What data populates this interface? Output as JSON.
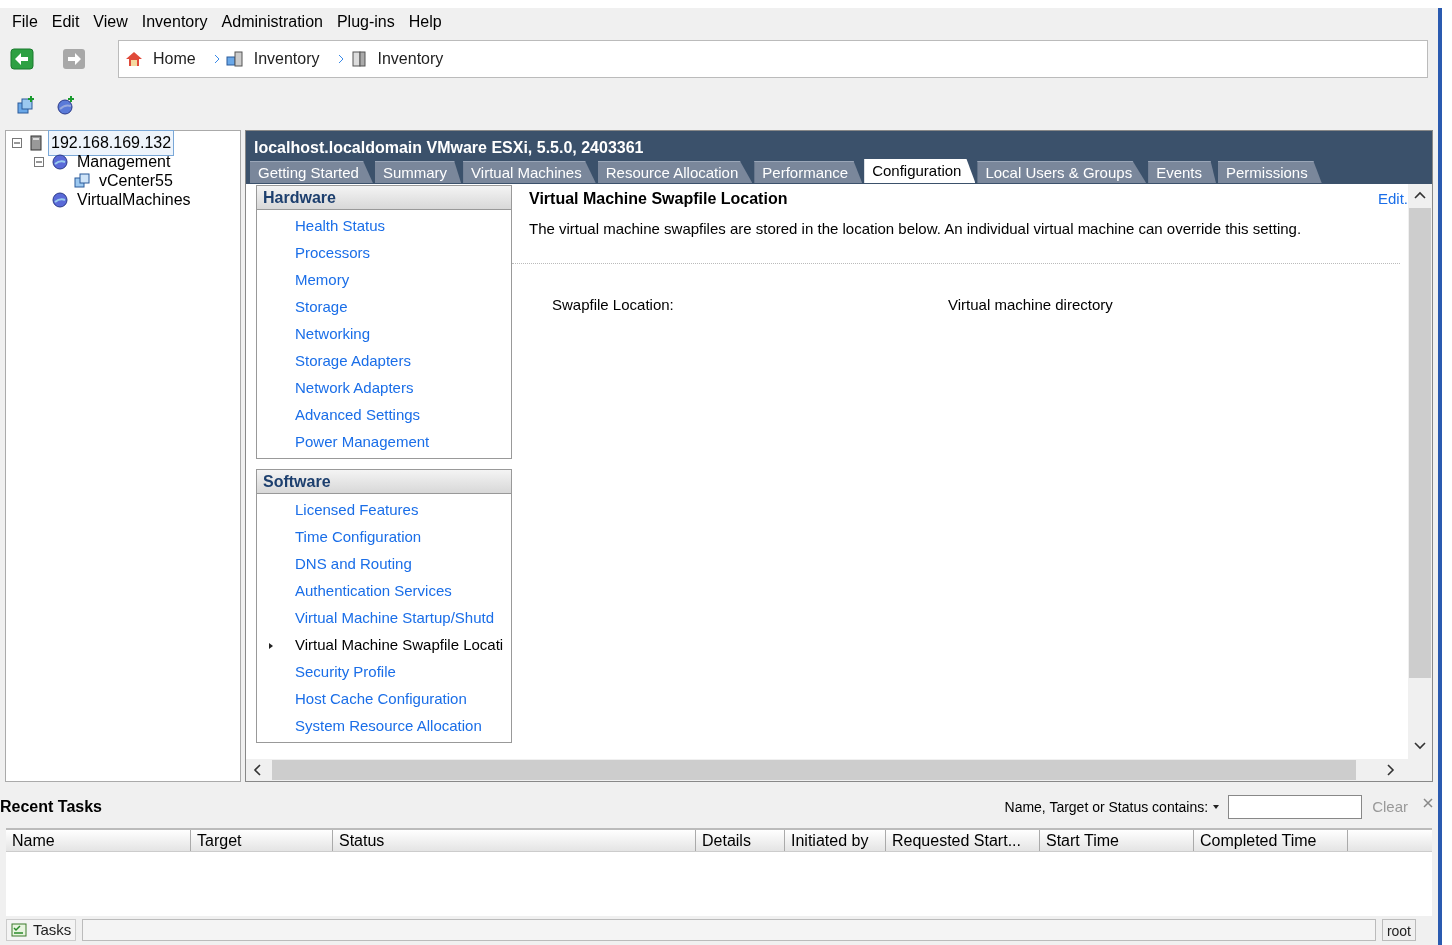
{
  "menu": [
    "File",
    "Edit",
    "View",
    "Inventory",
    "Administration",
    "Plug-ins",
    "Help"
  ],
  "breadcrumb": [
    {
      "kind": "home",
      "label": "Home"
    },
    {
      "kind": "inventory",
      "label": "Inventory"
    },
    {
      "kind": "host",
      "label": "Inventory"
    }
  ],
  "tree": [
    {
      "kind": "host",
      "label": "192.168.169.132",
      "selected": true,
      "expanded": true,
      "children": [
        {
          "kind": "pool",
          "label": "Management",
          "selected": false,
          "expanded": true,
          "children": [
            {
              "kind": "vm",
              "label": "vCenter55",
              "selected": false
            }
          ]
        },
        {
          "kind": "pool",
          "label": "VirtualMachines",
          "selected": false
        }
      ]
    }
  ],
  "host_title": "localhost.localdomain VMware ESXi, 5.5.0, 2403361",
  "tabs": [
    {
      "label": "Getting Started",
      "selected": false
    },
    {
      "label": "Summary",
      "selected": false
    },
    {
      "label": "Virtual Machines",
      "selected": false
    },
    {
      "label": "Resource Allocation",
      "selected": false
    },
    {
      "label": "Performance",
      "selected": false
    },
    {
      "label": "Configuration",
      "selected": true
    },
    {
      "label": "Local Users & Groups",
      "selected": false
    },
    {
      "label": "Events",
      "selected": false
    },
    {
      "label": "Permissions",
      "selected": false
    }
  ],
  "nav_sections": [
    {
      "title": "Hardware",
      "items": [
        {
          "label": "Health Status",
          "selected": false
        },
        {
          "label": "Processors",
          "selected": false
        },
        {
          "label": "Memory",
          "selected": false
        },
        {
          "label": "Storage",
          "selected": false
        },
        {
          "label": "Networking",
          "selected": false
        },
        {
          "label": "Storage Adapters",
          "selected": false
        },
        {
          "label": "Network Adapters",
          "selected": false
        },
        {
          "label": "Advanced Settings",
          "selected": false
        },
        {
          "label": "Power Management",
          "selected": false
        }
      ]
    },
    {
      "title": "Software",
      "items": [
        {
          "label": "Licensed Features",
          "selected": false
        },
        {
          "label": "Time Configuration",
          "selected": false
        },
        {
          "label": "DNS and Routing",
          "selected": false
        },
        {
          "label": "Authentication Services",
          "selected": false
        },
        {
          "label": "Virtual Machine Startup/Shutd",
          "selected": false
        },
        {
          "label": "Virtual Machine Swapfile Locati",
          "selected": true
        },
        {
          "label": "Security Profile",
          "selected": false
        },
        {
          "label": "Host Cache Configuration",
          "selected": false
        },
        {
          "label": "System Resource Allocation",
          "selected": false
        }
      ]
    }
  ],
  "content": {
    "title": "Virtual Machine Swapfile Location",
    "edit_link": "Edit.",
    "description": "The virtual machine swapfiles are stored in the location below. An individual virtual machine can override this setting.",
    "field_label": "Swapfile Location:",
    "field_value": "Virtual machine directory"
  },
  "recent_tasks": {
    "title": "Recent Tasks",
    "filter_label": "Name, Target or Status contains:",
    "clear": "Clear",
    "columns": [
      "Name",
      "Target",
      "Status",
      "Details",
      "Initiated by",
      "Requested Start...",
      "Start Time",
      "Completed Time"
    ]
  },
  "status_bar": {
    "tasks": "Tasks",
    "user": "root"
  }
}
